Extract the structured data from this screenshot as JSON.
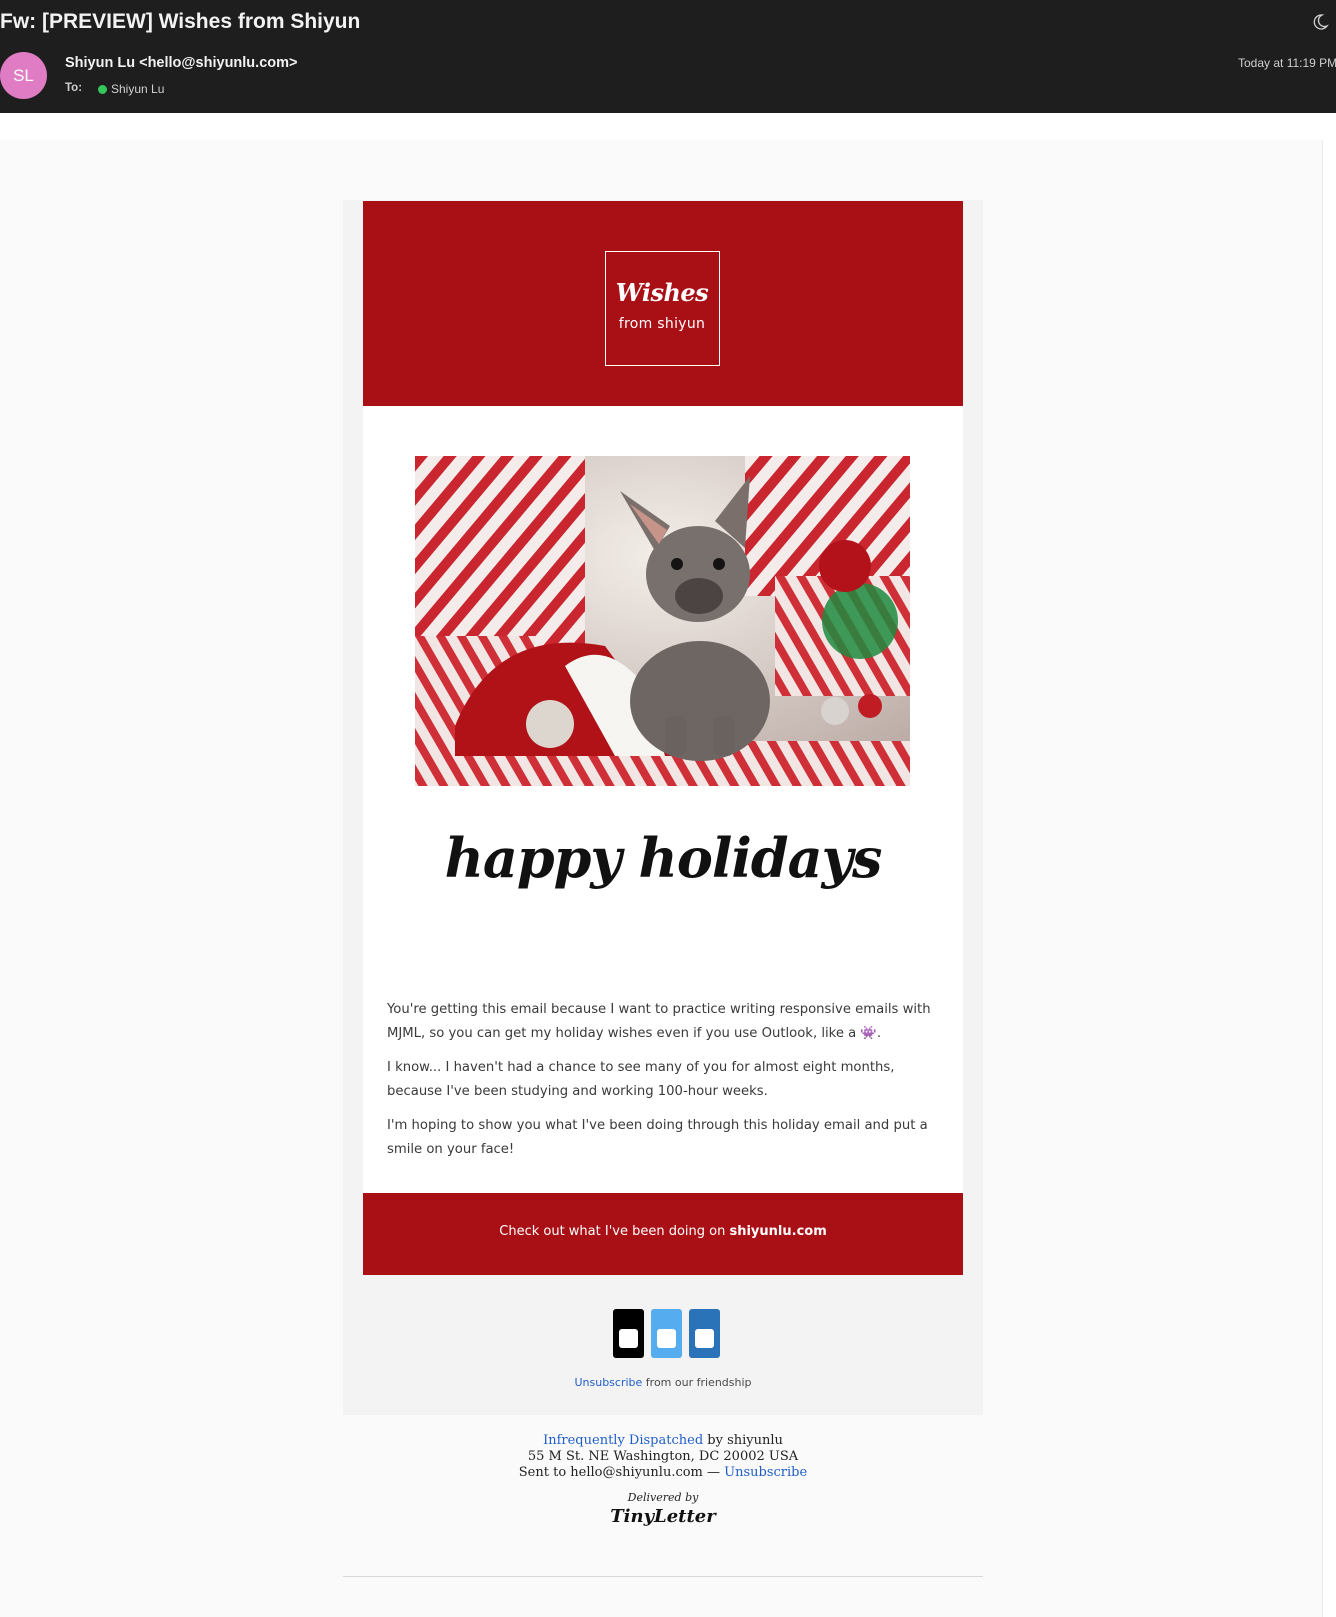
{
  "mail": {
    "subject": "Fw: [PREVIEW] Wishes from Shiyun",
    "avatar_initials": "SL",
    "avatar_color": "#e07cc4",
    "sender": "Shiyun Lu <hello@shiyunlu.com>",
    "to_label": "To:",
    "recipient": "Shiyun Lu",
    "timestamp": "Today at 11:19 PM",
    "icons": [
      "moon-icon",
      "presence-dot"
    ]
  },
  "email": {
    "accent_color": "#a91016",
    "logo": {
      "script": "Wishes",
      "sub": "from shiyun"
    },
    "photo_alt": "French bulldog puppy among red and white striped gift boxes",
    "headline": "happy holidays",
    "paragraphs": [
      "You're getting this email because I want to practice writing responsive emails with MJML, so you can get my holiday wishes even if you use Outlook, like a 👾.",
      "I know... I haven't had a chance to see many of you for almost eight months, because I've been studying and working 100-hour weeks.",
      "I'm hoping to show you what I've been doing through this holiday email and put a smile on your face!"
    ],
    "cta": {
      "prefix": "Check out what I've been doing on ",
      "link": "shiyunlu.com"
    },
    "social": [
      {
        "name": "social-icon-1",
        "color": "#000000"
      },
      {
        "name": "social-icon-2",
        "color": "#55acee"
      },
      {
        "name": "social-icon-3",
        "color": "#2a73b8"
      }
    ],
    "unsubscribe_link": "Unsubscribe",
    "unsubscribe_rest": " from our friendship"
  },
  "footer": {
    "newsletter_link": "Infrequently Dispatched",
    "by_text": " by shiyunlu",
    "address": "55 M St. NE Washington, DC 20002 USA",
    "sent_to": "Sent to hello@shiyunlu.com — ",
    "unsubscribe": "Unsubscribe",
    "delivered_by": "Delivered by",
    "brand": "TinyLetter"
  }
}
